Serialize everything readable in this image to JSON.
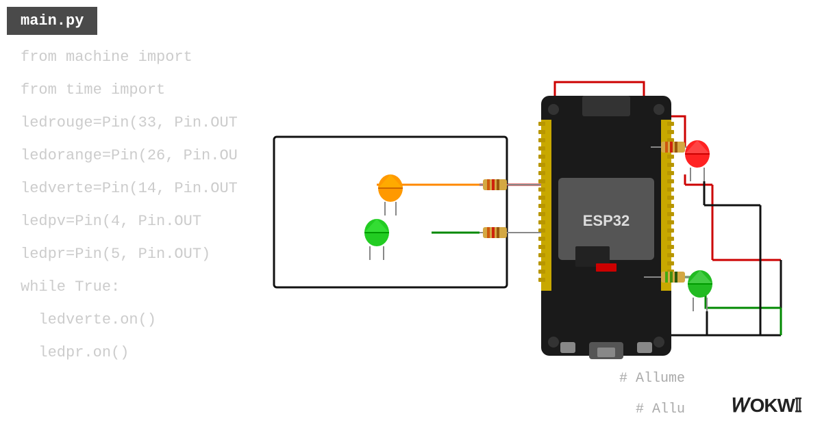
{
  "title": "main.py",
  "code_lines": [
    "from machine import",
    "from time import",
    "ledrouge=Pin(33, Pin.OUT",
    "ledorange=Pin(26, Pin.OU",
    "ledverte=Pin(14, Pin.OUT",
    "ledpv=Pin(4, Pin.OUT",
    "ledpr=Pin(5, Pin.OUT)",
    "while True:",
    "  ledverte.on()",
    "  ledpr.on()",
    "  --------"
  ],
  "comments": {
    "line1": "# Allume",
    "line2": "# Allu"
  },
  "logo": "WOKWI",
  "colors": {
    "bg": "#ffffff",
    "title_bg": "#4a4a4a",
    "title_text": "#ffffff",
    "code_text": "#cccccc",
    "wire_red": "#cc0000",
    "wire_green": "#008800",
    "wire_orange": "#ff8800",
    "wire_black": "#111111",
    "esp32_bg": "#1a1a1a",
    "esp32_module": "#555555",
    "esp32_label": "#dddddd",
    "led_red": "#ff2222",
    "led_green": "#22bb22",
    "resistor_body": "#d4a843",
    "logo_text": "#111111"
  }
}
